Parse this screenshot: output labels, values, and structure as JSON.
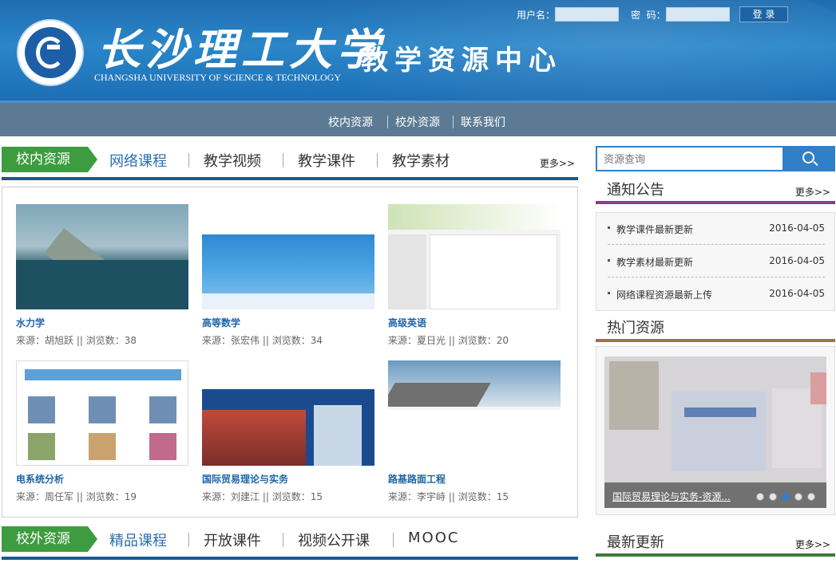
{
  "header": {
    "university_cn": "长沙理工大学",
    "university_en": "CHANGSHA UNIVERSITY OF SCIENCE & TECHNOLOGY",
    "center_title": "教学资源中心",
    "logo_text": "长沙理工大学",
    "username_label": "用户名：",
    "password_label": "密  码：",
    "login_button": "登 录"
  },
  "nav": {
    "items": [
      {
        "label": "校内资源"
      },
      {
        "label": "校外资源"
      },
      {
        "label": "联系我们"
      }
    ]
  },
  "internal": {
    "label": "校内资源",
    "tabs": [
      {
        "label": "网络课程"
      },
      {
        "label": "教学视频"
      },
      {
        "label": "教学课件"
      },
      {
        "label": "教学素材"
      }
    ],
    "more": "更多>>",
    "cards": [
      {
        "title": "水力学",
        "meta": "来源：胡旭跃 || 浏览数：38",
        "thumb": "dam-photo"
      },
      {
        "title": "高等数学",
        "meta": "来源：张宏伟 || 浏览数：34",
        "thumb": "math-course-page"
      },
      {
        "title": "高级英语",
        "meta": "来源：夏日光 || 浏览数：20",
        "thumb": "english-course-page"
      },
      {
        "title": "电系统分析",
        "meta": "来源：周任军 || 浏览数：19",
        "thumb": "power-system-diagram"
      },
      {
        "title": "国际贸易理论与实务",
        "meta": "来源：刘建江 || 浏览数：15",
        "thumb": "trade-course-page"
      },
      {
        "title": "路基路面工程",
        "meta": "来源：李宇峙 || 浏览数：15",
        "thumb": "road-course-page"
      }
    ]
  },
  "external": {
    "label": "校外资源",
    "tabs": [
      {
        "label": "精品课程"
      },
      {
        "label": "开放课件"
      },
      {
        "label": "视频公开课"
      },
      {
        "label": "MOOC"
      }
    ]
  },
  "sidebar": {
    "search_placeholder": "资源查询",
    "notices_title": "通知公告",
    "notices_more": "更多>>",
    "notices": [
      {
        "text": "教学课件最新更新",
        "date": "2016-04-05"
      },
      {
        "text": "教学素材最新更新",
        "date": "2016-04-05"
      },
      {
        "text": "网络课程资源最新上传",
        "date": "2016-04-05"
      }
    ],
    "hot_title": "热门资源",
    "hot_caption": "国际贸易理论与实务-资源...",
    "hot_active_slide": 3,
    "hot_slide_count": 5,
    "latest_title": "最新更新",
    "latest_more": "更多>>"
  },
  "colors": {
    "header_blue": "#2a86c9",
    "nav_gray": "#5c7a93",
    "section_green": "#3d9c3f",
    "section_underline": "#1a5a90",
    "notice_underline": "#8a3c86",
    "hot_underline": "#a0733a",
    "latest_underline": "#3f7a3a",
    "search_blue": "#2f80c8",
    "link_blue": "#1d65a9"
  }
}
